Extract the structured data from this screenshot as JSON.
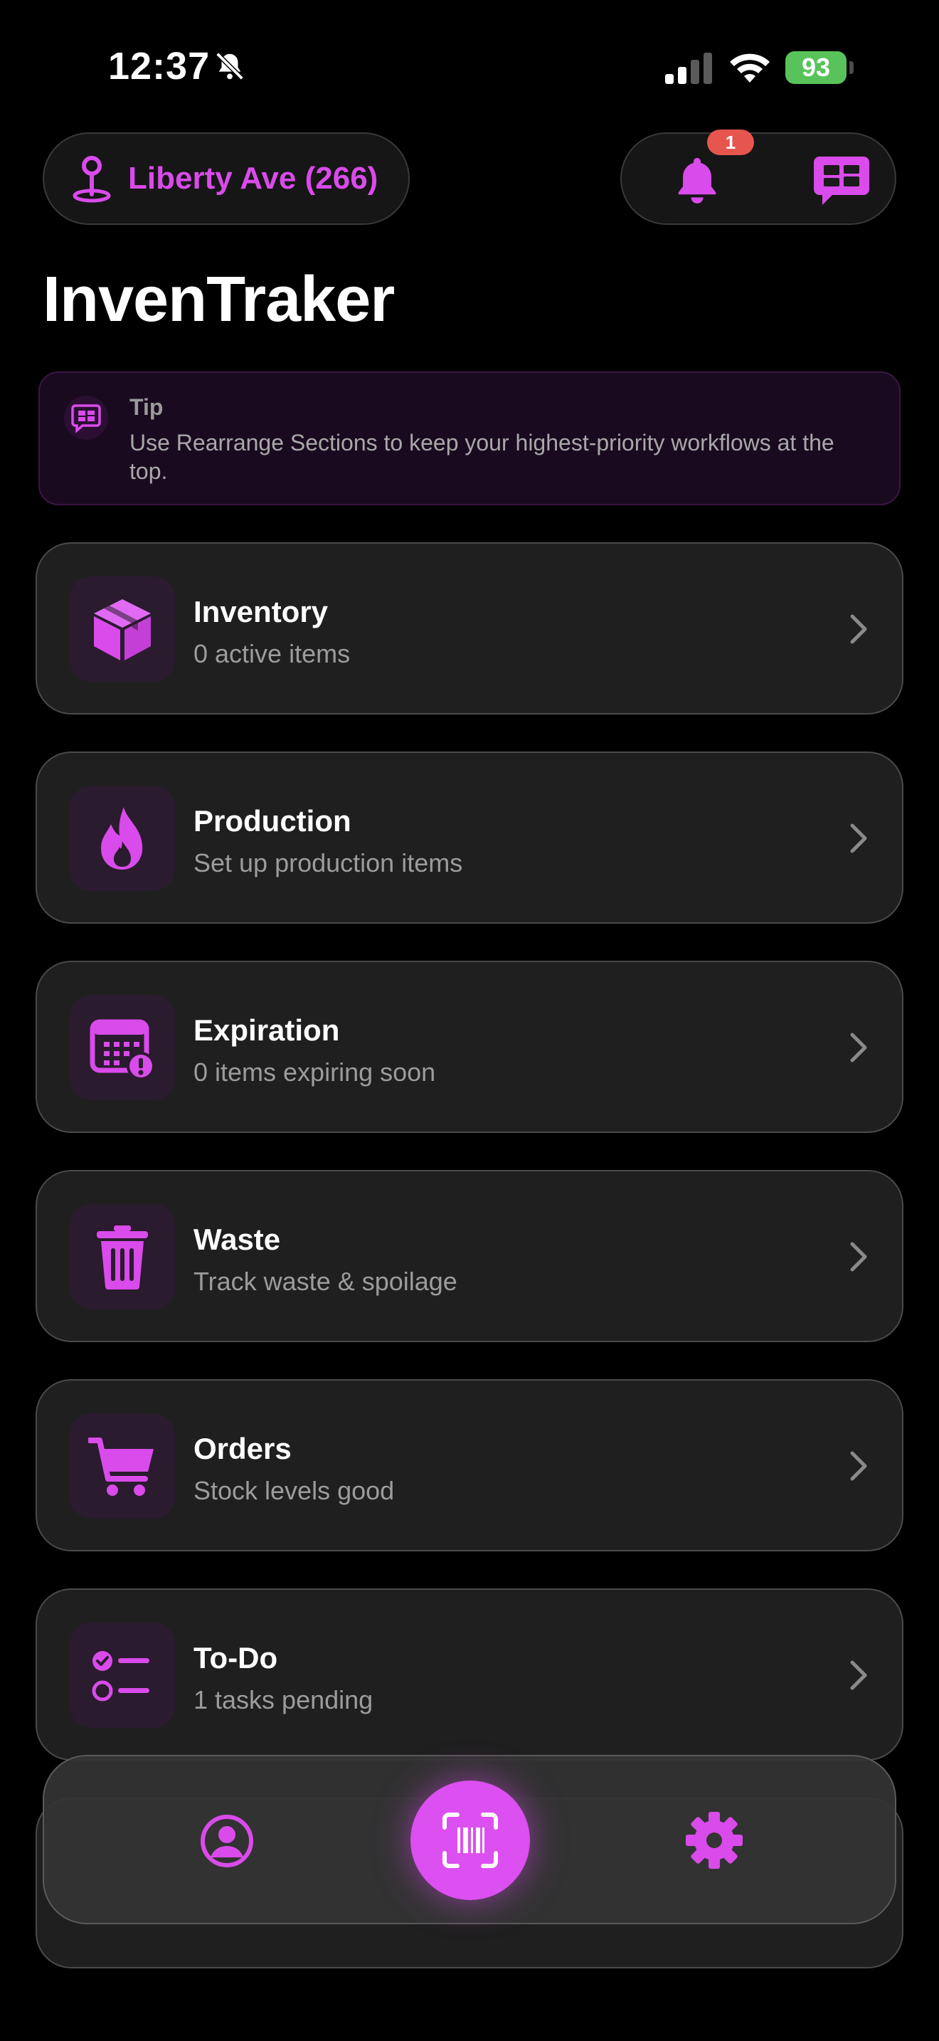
{
  "status_bar": {
    "time": "12:37",
    "battery": "93"
  },
  "header": {
    "location": "Liberty Ave (266)",
    "notification_badge": "1",
    "app_title": "InvenTraker"
  },
  "tip": {
    "label": "Tip",
    "text": "Use Rearrange Sections to keep your highest-priority workflows at the top."
  },
  "sections": [
    {
      "title": "Inventory",
      "subtitle": "0 active items",
      "icon": "box-icon"
    },
    {
      "title": "Production",
      "subtitle": "Set up production items",
      "icon": "flame-icon"
    },
    {
      "title": "Expiration",
      "subtitle": "0 items expiring soon",
      "icon": "calendar-alert-icon"
    },
    {
      "title": "Waste",
      "subtitle": "Track waste & spoilage",
      "icon": "trash-icon"
    },
    {
      "title": "Orders",
      "subtitle": "Stock levels good",
      "icon": "cart-icon"
    },
    {
      "title": "To-Do",
      "subtitle": "1 tasks pending",
      "icon": "checklist-icon"
    }
  ],
  "tab_bar": {
    "items": [
      "profile-icon",
      "barcode-scan-icon",
      "gear-icon"
    ]
  },
  "colors": {
    "accent": "#d94bea",
    "background": "#000000",
    "card": "#1f1f1f",
    "badge": "#e7554f"
  }
}
